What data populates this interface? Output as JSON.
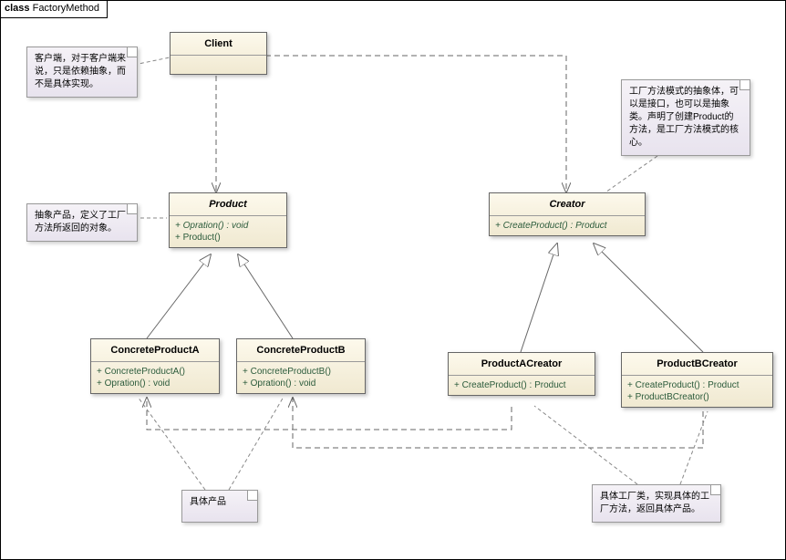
{
  "frame": {
    "prefix": "class",
    "title": "FactoryMethod"
  },
  "classes": {
    "client": {
      "name": "Client"
    },
    "product": {
      "name": "Product",
      "ops": [
        "Opration() : void",
        "Product()"
      ]
    },
    "creator": {
      "name": "Creator",
      "ops": [
        "CreateProduct() : Product"
      ]
    },
    "cpa": {
      "name": "ConcreteProductA",
      "ops": [
        "ConcreteProductA()",
        "Opration() : void"
      ]
    },
    "cpb": {
      "name": "ConcreteProductB",
      "ops": [
        "ConcreteProductB()",
        "Opration() : void"
      ]
    },
    "pac": {
      "name": "ProductACreator",
      "ops": [
        "CreateProduct() : Product"
      ]
    },
    "pbc": {
      "name": "ProductBCreator",
      "ops": [
        "CreateProduct() : Product",
        "ProductBCreator()"
      ]
    }
  },
  "notes": {
    "n1": "客户端，对于客户端来说，只是依赖抽象，而不是具体实现。",
    "n2": "工厂方法模式的抽象体，可以是接口，也可以是抽象类。声明了创建Product的方法，是工厂方法模式的核心。",
    "n3": "抽象产品，定义了工厂方法所返回的对象。",
    "n4": "具体产品",
    "n5": "具体工厂类，实现具体的工厂方法，返回具体产品。"
  }
}
